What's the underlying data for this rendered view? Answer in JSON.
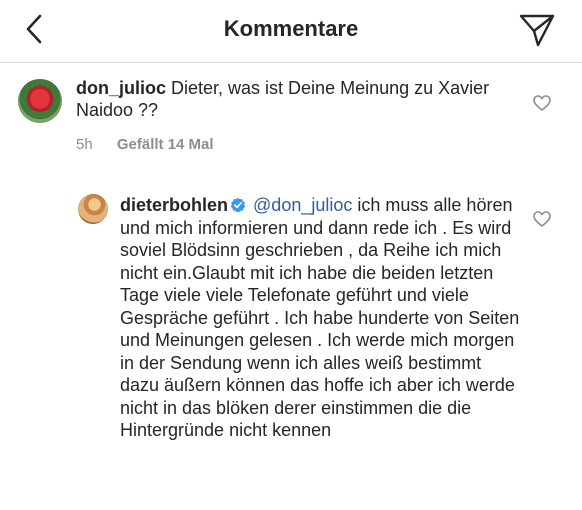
{
  "header": {
    "title": "Kommentare",
    "back_icon": "chevron-left-icon",
    "send_icon": "paper-plane-icon"
  },
  "comments": [
    {
      "username": "don_julioc",
      "text": "Dieter, was ist Deine Meinung zu Xavier Naidoo ??",
      "time": "5h",
      "likes": "Gefällt 14 Mal",
      "avatar_icon": "rose-avatar",
      "like_icon": "heart-outline-icon"
    },
    {
      "username": "dieterbohlen",
      "verified_icon": "verified-badge-icon",
      "mention": "@don_julioc",
      "text": "ich muss alle hören und mich informieren und dann rede ich . Es wird soviel Blödsinn geschrieben , da Reihe ich mich nicht ein.Glaubt mit ich habe die beiden letzten Tage viele viele Telefonate geführt und viele Gespräche geführt . Ich habe hunderte von Seiten und Meinungen gelesen . Ich werde mich morgen in der Sendung wenn ich alles weiß bestimmt dazu äußern können das hoffe ich aber ich werde nicht in das blöken derer einstimmen die die Hintergründe nicht kennen",
      "avatar_icon": "profile-photo-avatar",
      "like_icon": "heart-outline-icon"
    }
  ],
  "colors": {
    "text": "#262626",
    "muted": "#8e8e8e",
    "mention": "#2d5f99",
    "verified": "#3897f0",
    "divider": "#dbdbdb"
  }
}
